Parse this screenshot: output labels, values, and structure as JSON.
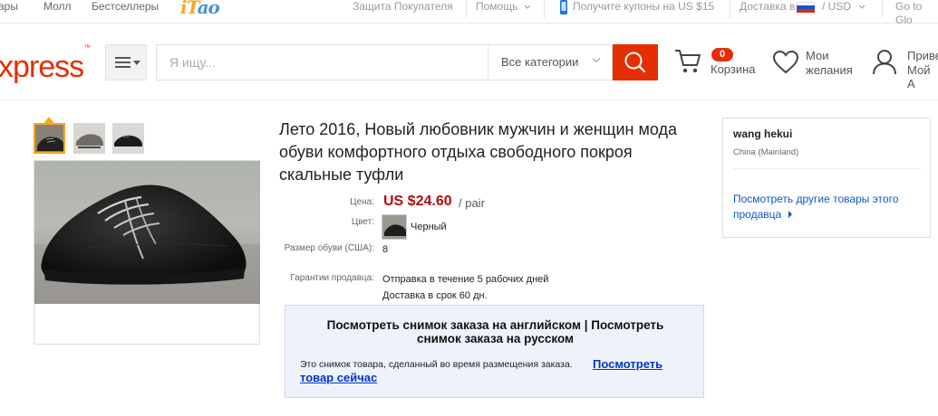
{
  "topbar": {
    "left_links": [
      "ары",
      "Молл",
      "Бестселлеры"
    ],
    "itao_logo": "iTao",
    "buyer_protection": "Защита Покупателя",
    "help": "Помощь",
    "coupon": "Получите купоны на US $15",
    "delivery": "Доставка в",
    "currency": "/ USD",
    "goto": "Go to Glo"
  },
  "header": {
    "logo": "xpress",
    "search_placeholder": "Я ищу...",
    "category": "Все категории",
    "cart_count": "0",
    "cart_label": "Корзина",
    "wishlist_line1": "Мои",
    "wishlist_line2": "желания",
    "account_line1": "Приве",
    "account_line2": "Мой А"
  },
  "product": {
    "title": "Лето 2016, Новый любовник мужчин и женщин мода обуви комфортного отдыха свободного покроя скальные туфли",
    "price_label": "Цена:",
    "price": "US $24.60",
    "price_unit": "/ pair",
    "color_label": "Цвет:",
    "color_value": "Черный",
    "size_label": "Размер обуви (США):",
    "size_value": "8",
    "guarantee_label": "Гарантии продавца:",
    "guarantee_line1": "Отправка в течение 5 рабочих дней",
    "guarantee_line2": "Доставка в срок 60 дн."
  },
  "snapshot": {
    "title_line1": "Посмотреть снимок заказа на английском | Посмотреть",
    "title_line2": "снимок заказа на русском",
    "note": "Это снимок товара, сделанный во время размещения заказа.",
    "link_part1": "Посмотреть",
    "link_part2": "товар сейчас"
  },
  "seller": {
    "name": "wang hekui",
    "country": "China (Mainland)",
    "link_line1": "Посмотреть другие товары этого",
    "link_line2": "продавца"
  },
  "colors": {
    "accent": "#e62e04",
    "price": "#b20c0c",
    "link": "#0b57c5"
  }
}
